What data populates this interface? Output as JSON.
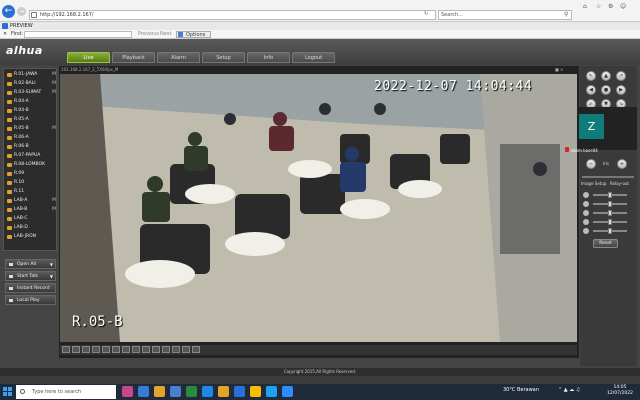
{
  "browser": {
    "url": "http://192.168.2.167/",
    "search_placeholder": "Search...",
    "tab_title": "PREVIEW",
    "find_label": "Find:",
    "find_prev": "Previous",
    "find_next": "Next",
    "options_label": "Options"
  },
  "app": {
    "logo": "alhua",
    "nav_tabs": [
      {
        "label": "Live",
        "active": true
      },
      {
        "label": "Playback",
        "active": false
      },
      {
        "label": "Alarm",
        "active": false
      },
      {
        "label": "Setup",
        "active": false
      },
      {
        "label": "Info",
        "active": false
      },
      {
        "label": "Logout",
        "active": false
      }
    ]
  },
  "sidebar": {
    "items": [
      {
        "label": "R.01-JAWA",
        "marker": "M"
      },
      {
        "label": "R.02-BALI",
        "marker": "M"
      },
      {
        "label": "R.03-SUMAT",
        "marker": "M"
      },
      {
        "label": "R.04-A",
        "marker": ""
      },
      {
        "label": "R.04-B",
        "marker": ""
      },
      {
        "label": "R.05-A",
        "marker": ""
      },
      {
        "label": "R.05-B",
        "marker": "M"
      },
      {
        "label": "R.06-A",
        "marker": ""
      },
      {
        "label": "R.06-B",
        "marker": ""
      },
      {
        "label": "R.07-PAPUA",
        "marker": ""
      },
      {
        "label": "R.08-LOMBOK",
        "marker": ""
      },
      {
        "label": "R.09",
        "marker": ""
      },
      {
        "label": "R.10",
        "marker": ""
      },
      {
        "label": "R.11",
        "marker": ""
      },
      {
        "label": "LAB-A",
        "marker": "M"
      },
      {
        "label": "LAB-B",
        "marker": "M"
      },
      {
        "label": "LAB-C",
        "marker": ""
      },
      {
        "label": "LAB-D",
        "marker": ""
      },
      {
        "label": "LAB-JRON",
        "marker": ""
      }
    ],
    "buttons": [
      {
        "label": "Open All"
      },
      {
        "label": "Start Talk"
      },
      {
        "label": "Instant Record"
      },
      {
        "label": "Local Play"
      }
    ]
  },
  "video": {
    "info_text": "192.168.2.167_2_TX60lps_M",
    "timestamp": "2022-12-07 14:04:44",
    "camera_label": "R.05-B"
  },
  "ptz": {
    "zoom_minus": "−",
    "zoom_label": "Iris",
    "zoom_plus": "+",
    "image_setup_label": "Image Setup",
    "relay_out_label": "Relay-out",
    "reset_label": "Reset",
    "slider_levels": [
      0.5,
      0.5,
      0.5,
      0.5,
      0.5,
      0.5
    ]
  },
  "zoom_overlay": {
    "avatar_letter": "Z",
    "name": "zoom base04"
  },
  "footer": {
    "copyright": "Copyright 2015,All Rights Reserved."
  },
  "taskbar": {
    "search_placeholder": "Type here to search",
    "weather": "30°C  Berawan",
    "time": "14:05",
    "date": "12/07/2022"
  }
}
